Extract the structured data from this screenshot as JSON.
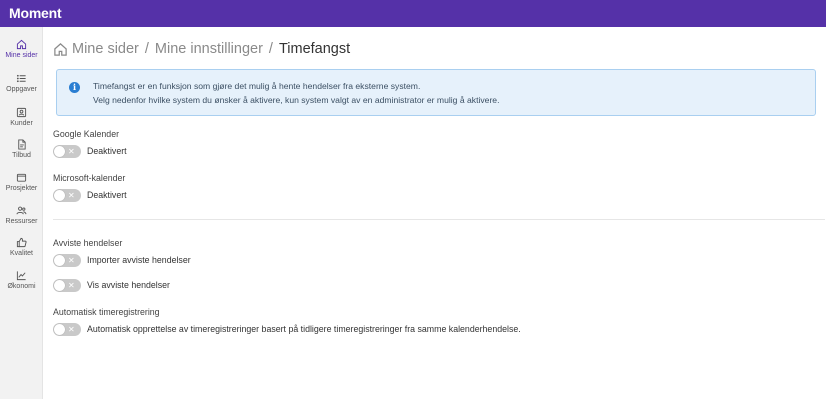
{
  "app": {
    "title": "Moment"
  },
  "sidebar": {
    "items": [
      {
        "label": "Mine sider",
        "icon": "home-icon",
        "active": true
      },
      {
        "label": "Oppgaver",
        "icon": "list-icon"
      },
      {
        "label": "Kunder",
        "icon": "contact-card-icon"
      },
      {
        "label": "Tilbud",
        "icon": "document-icon"
      },
      {
        "label": "Prosjekter",
        "icon": "folder-icon"
      },
      {
        "label": "Ressurser",
        "icon": "people-icon"
      },
      {
        "label": "Kvalitet",
        "icon": "thumbs-up-icon"
      },
      {
        "label": "Økonomi",
        "icon": "chart-icon"
      }
    ]
  },
  "breadcrumb": {
    "items": [
      "Mine sider",
      "Mine innstillinger",
      "Timefangst"
    ],
    "separator": "/"
  },
  "info": {
    "icon_glyph": "i",
    "line1": "Timefangst er en funksjon som gjøre det mulig å hente hendelser fra eksterne system.",
    "line2": "Velg nedenfor hvilke system du ønsker å aktivere, kun system valgt av en administrator er mulig å aktivere."
  },
  "settings": {
    "google": {
      "title": "Google Kalender",
      "toggle_label": "Deaktivert",
      "enabled": false
    },
    "microsoft": {
      "title": "Microsoft-kalender",
      "toggle_label": "Deaktivert",
      "enabled": false
    },
    "rejected": {
      "title": "Avviste hendelser",
      "import_label": "Importer avviste hendelser",
      "show_label": "Vis avviste hendelser",
      "import_enabled": false,
      "show_enabled": false
    },
    "auto": {
      "title": "Automatisk timeregistrering",
      "toggle_label": "Automatisk opprettelse av timeregistreringer basert på tidligere timeregistreringer fra samme kalenderhendelse.",
      "enabled": false
    }
  },
  "toggle_off_glyph": "✕",
  "colors": {
    "brand": "#5531a8",
    "info_bg": "#e6f1fb",
    "info_border": "#a9cff0",
    "toggle_off": "#c9c9c9"
  }
}
